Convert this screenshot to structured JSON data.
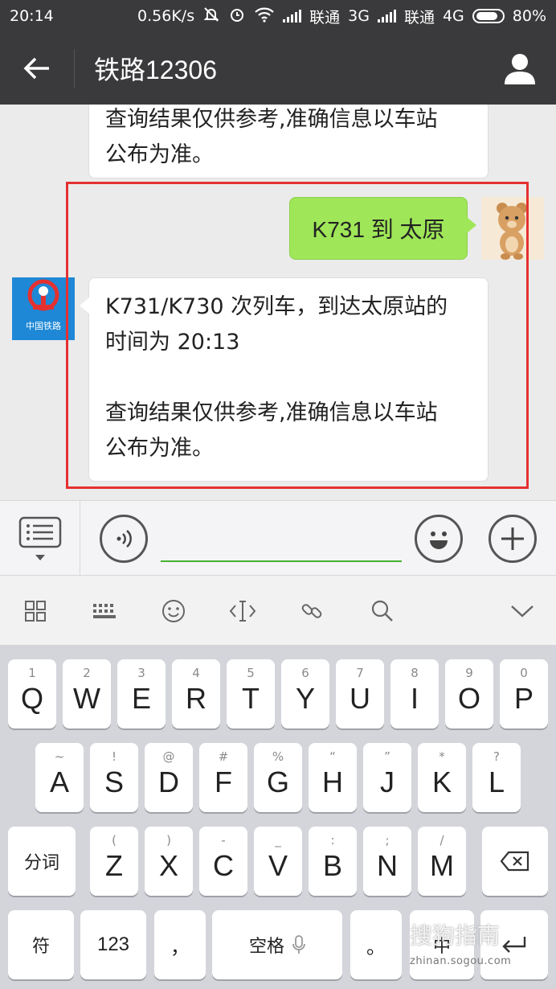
{
  "status_bar": {
    "time": "20:14",
    "speed": "0.56K/s",
    "carrier1": "联通",
    "net1": "3G",
    "carrier2": "联通",
    "net2": "4G",
    "battery": "80%"
  },
  "header": {
    "title": "铁路12306"
  },
  "chat": {
    "prev_reply": {
      "line1": "查询结果仅供参考,准确信息以车站",
      "line2": "公布为准。"
    },
    "user_message": "K731 到 太原",
    "bot_avatar_text": "中国铁路",
    "bot_reply": {
      "line1": "K731/K730 次列车，到达太原站的",
      "line2": "时间为 20:13",
      "line3": "查询结果仅供参考,准确信息以车站",
      "line4": "公布为准。"
    }
  },
  "keyboard": {
    "row1": [
      {
        "hint": "1",
        "label": "Q"
      },
      {
        "hint": "2",
        "label": "W"
      },
      {
        "hint": "3",
        "label": "E"
      },
      {
        "hint": "4",
        "label": "R"
      },
      {
        "hint": "5",
        "label": "T"
      },
      {
        "hint": "6",
        "label": "Y"
      },
      {
        "hint": "7",
        "label": "U"
      },
      {
        "hint": "8",
        "label": "I"
      },
      {
        "hint": "9",
        "label": "O"
      },
      {
        "hint": "0",
        "label": "P"
      }
    ],
    "row2": [
      {
        "hint": "~",
        "label": "A"
      },
      {
        "hint": "!",
        "label": "S"
      },
      {
        "hint": "@",
        "label": "D"
      },
      {
        "hint": "#",
        "label": "F"
      },
      {
        "hint": "%",
        "label": "G"
      },
      {
        "hint": "“",
        "label": "H"
      },
      {
        "hint": "”",
        "label": "J"
      },
      {
        "hint": "*",
        "label": "K"
      },
      {
        "hint": "?",
        "label": "L"
      }
    ],
    "row3": [
      {
        "hint": "(",
        "label": "Z"
      },
      {
        "hint": ")",
        "label": "X"
      },
      {
        "hint": "-",
        "label": "C"
      },
      {
        "hint": "_",
        "label": "V"
      },
      {
        "hint": ":",
        "label": "B"
      },
      {
        "hint": ";",
        "label": "N"
      },
      {
        "hint": "/",
        "label": "M"
      }
    ],
    "segment_label": "分词",
    "symbol_label": "符",
    "numbers_label": "123",
    "comma_label": "，",
    "space_label": "空格",
    "period_label": "。",
    "lang_label": "中"
  },
  "watermark": {
    "text": "搜狗指南",
    "url": "zhinan.sogou.com"
  }
}
